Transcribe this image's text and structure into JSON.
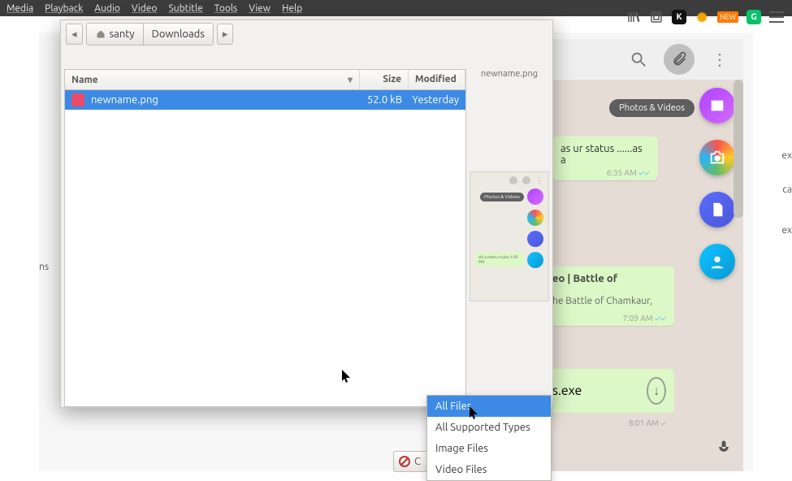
{
  "menubar": {
    "items": [
      "Media",
      "Playback",
      "Audio",
      "Video",
      "Subtitle",
      "Tools",
      "View",
      "Help"
    ]
  },
  "browser_tools": {
    "icons": [
      "library-icon",
      "reader-icon",
      "k-badge",
      "sunflower-icon",
      "new-badge",
      "grammarly-icon",
      "menu-icon"
    ],
    "new_label": "NEW",
    "k_label": "K",
    "g_label": "G"
  },
  "whatsapp": {
    "header_icons": [
      "search-icon",
      "attach-icon",
      "menu-dots-icon"
    ],
    "left_trunc": "ns",
    "right_trunc": [
      "ex",
      "ca",
      "ex"
    ],
    "attach_options": {
      "photos_label": "Photos & Videos",
      "fabs": [
        {
          "name": "photos-fab",
          "gradient": [
            "#b042ff",
            "#d36bff"
          ]
        },
        {
          "name": "camera-fab",
          "gradient": "conic"
        },
        {
          "name": "document-fab",
          "gradient": [
            "#5b6cff",
            "#4a57d6"
          ]
        },
        {
          "name": "contact-fab",
          "gradient": [
            "#0ec3ff",
            "#0b98d6"
          ]
        }
      ]
    },
    "messages": [
      {
        "text_frag": "as ur status ......as a",
        "time": "6:35 AM",
        "ticks": "read"
      },
      {
        "title_frag": "eo | Battle of",
        "body_frag": "he Battle of Chamkaur,",
        "time": "7:09 AM",
        "ticks": "read"
      },
      {
        "file_frag": "s.exe",
        "time": "8:01 AM",
        "ticks": "sent"
      }
    ]
  },
  "dialog": {
    "path": {
      "back": "◂",
      "home": "santy",
      "current": "Downloads",
      "fwd": "▸"
    },
    "columns": {
      "name": "Name",
      "size": "Size",
      "modified": "Modified",
      "sort": "▾"
    },
    "rows": [
      {
        "name": "newname.png",
        "size": "52.0 kB",
        "modified": "Yesterday"
      }
    ],
    "preview_title": "newname.png",
    "thumb_pill": "Photos & Videos",
    "thumb_bubble": "shi a menu ni pta       1:05 PM",
    "cancel": "C"
  },
  "dropdown": {
    "items": [
      "All Files",
      "All Supported Types",
      "Image Files",
      "Video Files"
    ],
    "selected": 0
  }
}
